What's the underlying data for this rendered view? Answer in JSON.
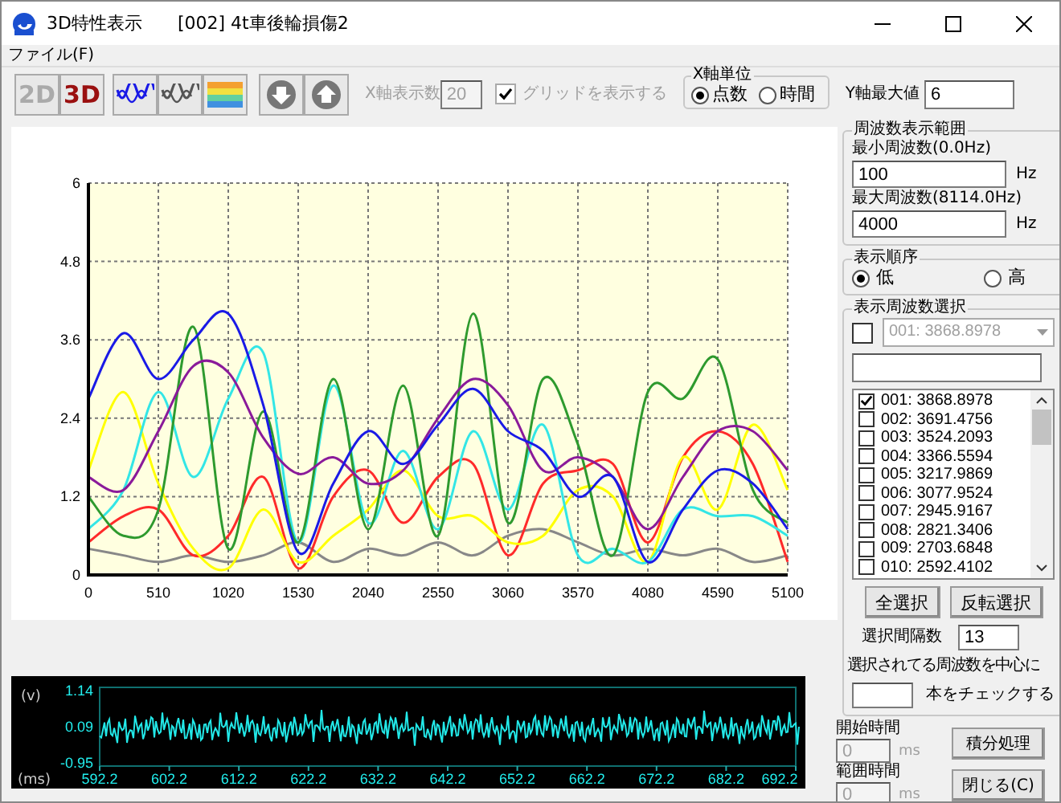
{
  "window": {
    "title": "3D特性表示",
    "document": "[002] 4t車後輪損傷2"
  },
  "menu": [
    {
      "label": "ファイル(F)"
    }
  ],
  "toolbar": {
    "view_buttons": [
      {
        "label": "2D",
        "selected": false
      },
      {
        "label": "3D",
        "selected": true
      }
    ],
    "x_count": {
      "label": "X軸表示数",
      "value": "20",
      "disabled": true
    },
    "grid": {
      "label": "グリッドを表示する",
      "checked": true,
      "disabled": true
    },
    "x_unit": {
      "title": "X軸単位",
      "options": [
        {
          "label": "点数",
          "selected": true
        },
        {
          "label": "時間",
          "selected": false
        }
      ]
    },
    "y_max": {
      "label": "Y軸最大値",
      "value": "6"
    }
  },
  "chart": {
    "chart_data": {
      "type": "line",
      "x": [
        0,
        255,
        510,
        765,
        1020,
        1275,
        1530,
        1785,
        2040,
        2295,
        2550,
        2805,
        3060,
        3315,
        3570,
        3825,
        4080,
        4335,
        4590,
        4845,
        5100
      ],
      "xlim": [
        0,
        5100
      ],
      "ylim": [
        0,
        6
      ],
      "xticks": [
        0,
        510,
        1020,
        1530,
        2040,
        2550,
        3060,
        3570,
        4080,
        4590,
        5100
      ],
      "yticks": [
        0,
        1.2,
        2.4,
        3.6,
        4.8,
        6
      ],
      "grid": true,
      "series": [
        {
          "color": "#888888",
          "values": [
            0.4,
            0.3,
            0.2,
            0.3,
            0.2,
            0.3,
            0.5,
            0.2,
            0.4,
            0.3,
            0.5,
            0.3,
            0.6,
            0.7,
            0.5,
            0.3,
            0.4,
            0.3,
            0.4,
            0.2,
            0.3
          ]
        },
        {
          "color": "#ff2a2a",
          "values": [
            0.5,
            0.9,
            1.0,
            0.3,
            0.6,
            1.5,
            0.1,
            1.2,
            1.6,
            0.8,
            1.5,
            1.7,
            0.3,
            1.4,
            1.6,
            1.7,
            0.5,
            1.8,
            2.2,
            1.7,
            0.2
          ]
        },
        {
          "color": "#ffff00",
          "values": [
            1.6,
            2.8,
            1.4,
            0.4,
            0.1,
            1.0,
            0.2,
            0.6,
            1.0,
            1.6,
            0.9,
            0.9,
            0.5,
            0.6,
            1.3,
            1.2,
            0.2,
            1.8,
            1.0,
            2.3,
            1.3
          ]
        },
        {
          "color": "#33e6e6",
          "values": [
            0.7,
            1.3,
            2.8,
            1.5,
            2.7,
            3.4,
            0.5,
            2.9,
            0.8,
            1.9,
            0.7,
            2.2,
            1.0,
            2.3,
            0.3,
            0.4,
            0.2,
            1.0,
            0.9,
            0.9,
            0.6
          ]
        },
        {
          "color": "#2e9a2e",
          "values": [
            1.2,
            0.6,
            1.0,
            3.8,
            0.4,
            2.5,
            0.5,
            3.0,
            0.7,
            2.9,
            0.6,
            4.0,
            0.8,
            3.0,
            2.0,
            0.3,
            2.8,
            2.7,
            3.3,
            1.3,
            0.8
          ]
        },
        {
          "color": "#8a1a9a",
          "values": [
            1.5,
            1.3,
            2.2,
            3.2,
            3.1,
            2.1,
            1.55,
            1.8,
            1.4,
            1.6,
            2.4,
            3.0,
            2.6,
            1.6,
            1.8,
            1.5,
            0.7,
            1.5,
            2.2,
            2.2,
            1.6
          ]
        },
        {
          "color": "#1a1ae6",
          "values": [
            2.7,
            3.7,
            3.0,
            3.6,
            4.0,
            2.6,
            0.35,
            1.4,
            2.2,
            1.7,
            2.3,
            2.85,
            2.2,
            1.9,
            1.2,
            1.5,
            0.2,
            1.0,
            1.6,
            1.4,
            0.7
          ]
        }
      ]
    }
  },
  "waveform": {
    "y_unit": "(v)",
    "x_unit": "(ms)",
    "y_labels": [
      "1.14",
      "0.09",
      "-0.95"
    ],
    "x_labels": [
      "592.2",
      "602.2",
      "612.2",
      "622.2",
      "632.2",
      "642.2",
      "652.2",
      "662.2",
      "672.2",
      "682.2",
      "692.2"
    ]
  },
  "frequency_range": {
    "title": "周波数表示範囲",
    "fields": [
      {
        "label": "最小周波数(0.0Hz)",
        "value": "100",
        "unit": "Hz"
      },
      {
        "label": "最大周波数(8114.0Hz)",
        "value": "4000",
        "unit": "Hz"
      }
    ]
  },
  "order": {
    "title": "表示順序",
    "options": [
      {
        "label": "低",
        "selected": true
      },
      {
        "label": "高",
        "selected": false
      }
    ]
  },
  "selection": {
    "title": "表示周波数選択",
    "combo": {
      "checked": false,
      "value": "001: 3868.8978",
      "disabled": true
    },
    "items": [
      {
        "label": "001: 3868.8978",
        "checked": true
      },
      {
        "label": "002: 3691.4756",
        "checked": false
      },
      {
        "label": "003: 3524.2093",
        "checked": false
      },
      {
        "label": "004: 3366.5594",
        "checked": false
      },
      {
        "label": "005: 3217.9869",
        "checked": false
      },
      {
        "label": "006: 3077.9524",
        "checked": false
      },
      {
        "label": "007: 2945.9167",
        "checked": false
      },
      {
        "label": "008: 2821.3406",
        "checked": false
      },
      {
        "label": "009: 2703.6848",
        "checked": false
      },
      {
        "label": "010: 2592.4102",
        "checked": false
      }
    ],
    "buttons": [
      "全選択",
      "反転選択"
    ],
    "interval": {
      "label": "選択間隔数",
      "value": "13"
    },
    "center_note": "選択されてる周波数を中心に",
    "count_suffix": "本をチェックする"
  },
  "time": {
    "fields": [
      {
        "label": "開始時間",
        "value": "0",
        "unit": "ms",
        "disabled": true
      },
      {
        "label": "範囲時間",
        "value": "0",
        "unit": "ms",
        "disabled": true
      }
    ],
    "buttons": [
      "積分処理",
      "閉じる(C)"
    ]
  }
}
